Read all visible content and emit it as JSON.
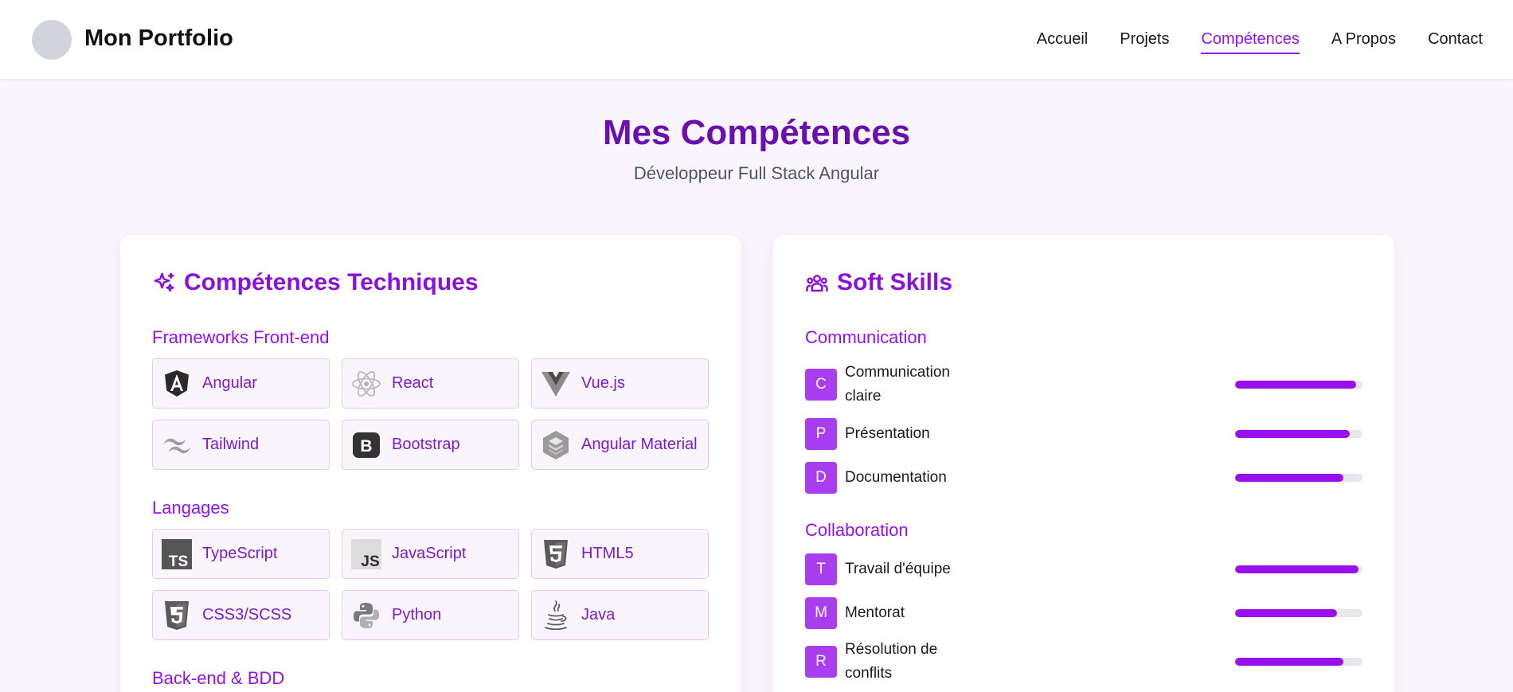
{
  "header": {
    "brand": "Mon Portfolio",
    "nav": [
      {
        "label": "Accueil",
        "active": false
      },
      {
        "label": "Projets",
        "active": false
      },
      {
        "label": "Compétences",
        "active": true
      },
      {
        "label": "A Propos",
        "active": false
      },
      {
        "label": "Contact",
        "active": false
      }
    ]
  },
  "hero": {
    "title": "Mes Compétences",
    "subtitle": "Développeur Full Stack Angular"
  },
  "technical": {
    "title": "Compétences Techniques",
    "icon": "sparkles-icon",
    "sections": [
      {
        "label": "Frameworks Front-end",
        "items": [
          {
            "label": "Angular",
            "icon": "angular-icon"
          },
          {
            "label": "React",
            "icon": "react-icon"
          },
          {
            "label": "Vue.js",
            "icon": "vue-icon"
          },
          {
            "label": "Tailwind",
            "icon": "tailwind-icon"
          },
          {
            "label": "Bootstrap",
            "icon": "bootstrap-icon"
          },
          {
            "label": "Angular Material",
            "icon": "angular-material-icon"
          }
        ]
      },
      {
        "label": "Langages",
        "items": [
          {
            "label": "TypeScript",
            "icon": "typescript-icon"
          },
          {
            "label": "JavaScript",
            "icon": "javascript-icon"
          },
          {
            "label": "HTML5",
            "icon": "html5-icon"
          },
          {
            "label": "CSS3/SCSS",
            "icon": "css3-icon"
          },
          {
            "label": "Python",
            "icon": "python-icon"
          },
          {
            "label": "Java",
            "icon": "java-icon"
          }
        ]
      },
      {
        "label": "Back-end & BDD",
        "items": []
      }
    ]
  },
  "soft": {
    "title": "Soft Skills",
    "icon": "users-icon",
    "sections": [
      {
        "label": "Communication",
        "items": [
          {
            "letter": "C",
            "label": "Communication claire",
            "level": 0.95
          },
          {
            "letter": "P",
            "label": "Présentation",
            "level": 0.9
          },
          {
            "letter": "D",
            "label": "Documentation",
            "level": 0.85
          }
        ]
      },
      {
        "label": "Collaboration",
        "items": [
          {
            "letter": "T",
            "label": "Travail d'équipe",
            "level": 0.97
          },
          {
            "letter": "M",
            "label": "Mentorat",
            "level": 0.8
          },
          {
            "letter": "R",
            "label": "Résolution de conflits",
            "level": 0.85
          }
        ]
      }
    ]
  },
  "colors": {
    "accent": "#9810ee",
    "title": "#6a0fb0",
    "background": "#faf5fd",
    "chip_border": "#e6c8f5",
    "badge": "#a93ef0"
  }
}
